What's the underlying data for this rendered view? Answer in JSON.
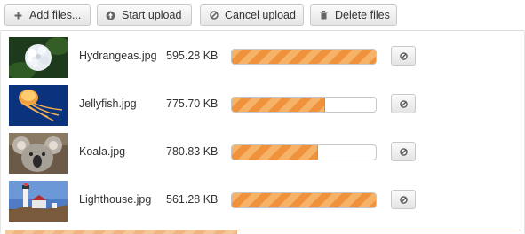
{
  "toolbar": {
    "add_label": "Add files...",
    "start_label": "Start upload",
    "cancel_label": "Cancel upload",
    "delete_label": "Delete files",
    "add_icon": "plus",
    "start_icon": "circle-arrow-up",
    "cancel_icon": "ban",
    "delete_icon": "trash"
  },
  "files": [
    {
      "name": "Hydrangeas.jpg",
      "size": "595.28 KB",
      "progress": 1.0,
      "thumbnail": "hydrangeas-flower-image",
      "cancel_icon": "ban"
    },
    {
      "name": "Jellyfish.jpg",
      "size": "775.70 KB",
      "progress": 0.65,
      "thumbnail": "jellyfish-image",
      "cancel_icon": "ban"
    },
    {
      "name": "Koala.jpg",
      "size": "780.83 KB",
      "progress": 0.6,
      "thumbnail": "koala-image",
      "cancel_icon": "ban"
    },
    {
      "name": "Lighthouse.jpg",
      "size": "561.28 KB",
      "progress": 1.0,
      "thumbnail": "lighthouse-image",
      "cancel_icon": "ban"
    }
  ],
  "global_progress": 0.45,
  "colors": {
    "progress_light": "#f6b267",
    "progress_dark": "#f0913c",
    "button_border": "#c9c9c9"
  }
}
